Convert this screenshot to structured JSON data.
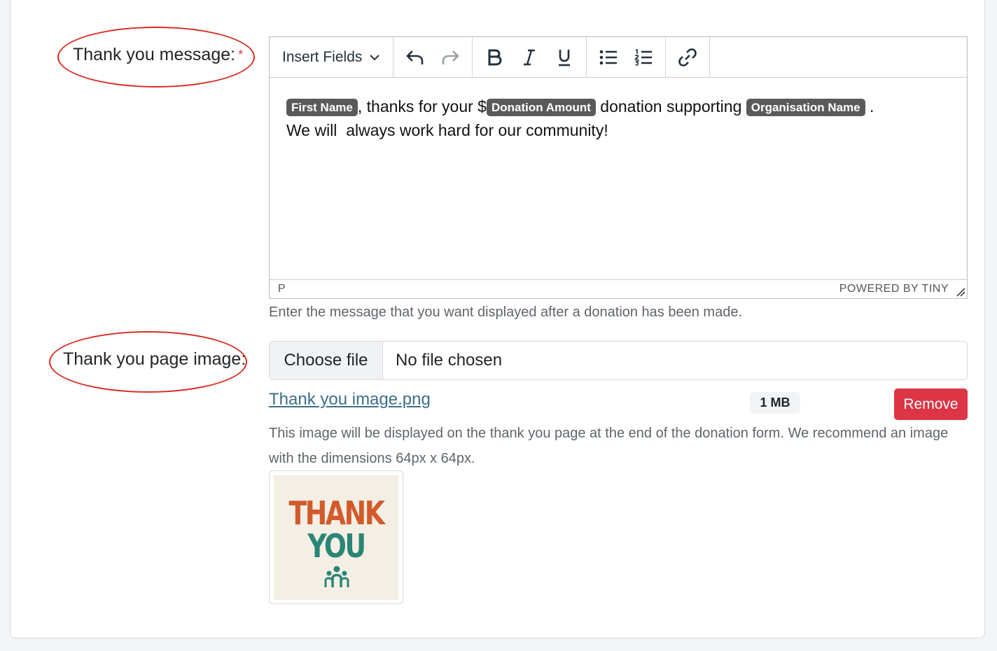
{
  "message_field": {
    "label": "Thank you message:",
    "required_marker": "*",
    "toolbar": {
      "insert_fields_label": "Insert Fields",
      "icons": [
        "undo-icon",
        "redo-icon",
        "bold-icon",
        "italic-icon",
        "underline-icon",
        "bullet-list-icon",
        "numbered-list-icon",
        "link-icon"
      ]
    },
    "content": {
      "line1_tag1": "First Name",
      "line1_text1": ", thanks for your $",
      "line1_tag2": "Donation Amount",
      "line1_text2": " donation supporting ",
      "line1_tag3": "Organisation Name",
      "line1_text3": " .",
      "line2": "We will  always work hard for our community!"
    },
    "statusbar": {
      "path": "P",
      "branding": "POWERED BY TINY"
    },
    "help_text": "Enter the message that you want displayed after a donation has been made."
  },
  "image_field": {
    "label": "Thank you page image:",
    "choose_button": "Choose file",
    "file_status": "No file chosen",
    "file_name": "Thank you image.png",
    "file_size": "1 MB",
    "remove_button": "Remove",
    "help_text": "This image will be displayed on the thank you page at the end of the donation form. We recommend an image with the dimensions 64px x 64px.",
    "thumbnail": {
      "line1": "THANK",
      "line2": "YOU"
    }
  },
  "colors": {
    "accent_red": "#dc3545",
    "annotation_red": "#d92b20",
    "link": "#3d6e8a",
    "tag_bg": "#5a5a5a"
  }
}
